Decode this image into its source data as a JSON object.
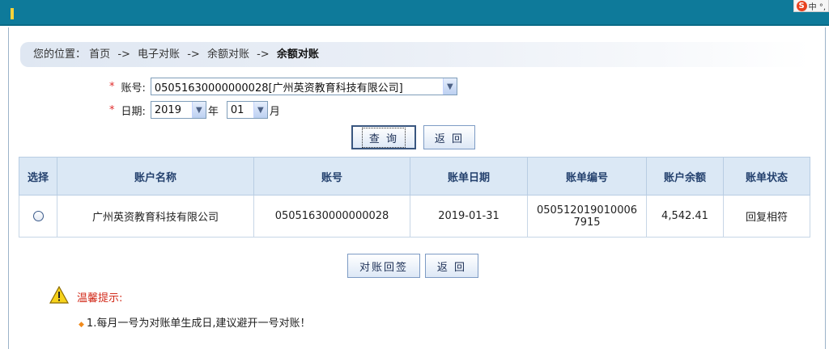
{
  "ime": {
    "logo": "S",
    "label": "中 °,"
  },
  "breadcrumb": {
    "prefix": "您的位置：",
    "items": [
      "首页",
      "电子对账",
      "余额对账"
    ],
    "separator": "->",
    "current": "余额对账"
  },
  "form": {
    "account": {
      "required_mark": "*",
      "label": "账号:",
      "value": "05051630000000028[广州英资教育科技有限公司]"
    },
    "date": {
      "required_mark": "*",
      "label": "日期:",
      "year": "2019",
      "year_unit": "年",
      "month": "01",
      "month_unit": "月"
    }
  },
  "buttons": {
    "query": "查 询",
    "back": "返 回",
    "reply": "对账回签",
    "back2": "返 回"
  },
  "table": {
    "columns": [
      "选择",
      "账户名称",
      "账号",
      "账单日期",
      "账单编号",
      "账户余额",
      "账单状态"
    ],
    "rows": [
      {
        "name": "广州英资教育科技有限公司",
        "account": "05051630000000028",
        "date": "2019-01-31",
        "bill_no": "05051201901000679 15",
        "bill_no_line1": "050512019010006",
        "bill_no_line2": "7915",
        "balance": "4,542.41",
        "status": "回复相符"
      }
    ]
  },
  "tips": {
    "title": "温馨提示:",
    "items": [
      "1.每月一号为对账单生成日,建议避开一号对账！"
    ]
  },
  "colors": {
    "topbar": "#0e7a9a",
    "header_bg": "#dbe8f5",
    "tip_red": "#d22a1a"
  },
  "icons": {
    "warning": "warning-icon",
    "dropdown": "chevron-down-icon"
  }
}
